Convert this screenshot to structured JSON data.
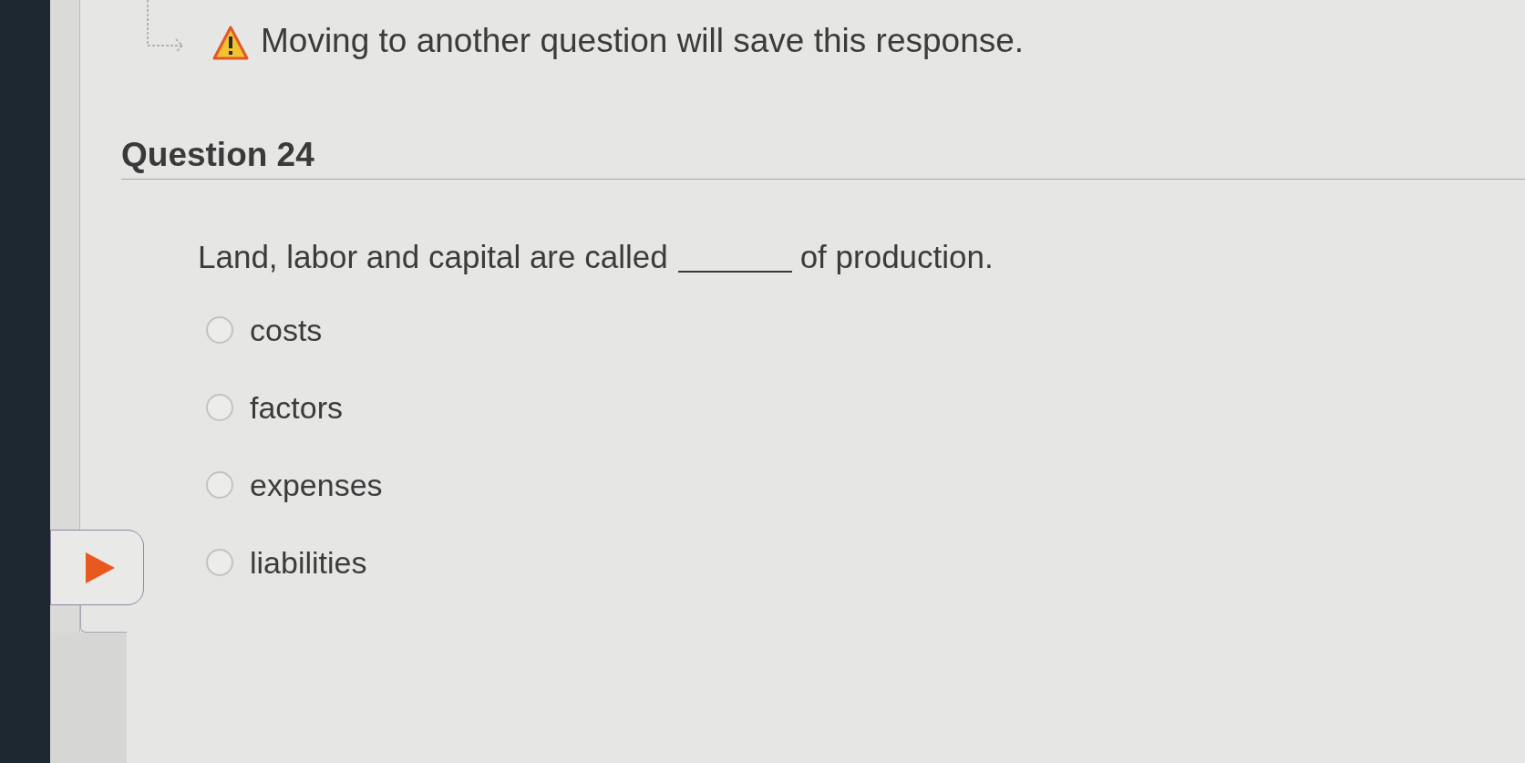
{
  "notice": {
    "text": "Moving to another question will save this response."
  },
  "question": {
    "title": "Question 24",
    "prompt": {
      "before": "Land, labor and capital are called",
      "after": "of production."
    },
    "options": [
      {
        "label": "costs",
        "selected": false
      },
      {
        "label": "factors",
        "selected": false
      },
      {
        "label": "expenses",
        "selected": false
      },
      {
        "label": "liabilities",
        "selected": false
      }
    ]
  }
}
